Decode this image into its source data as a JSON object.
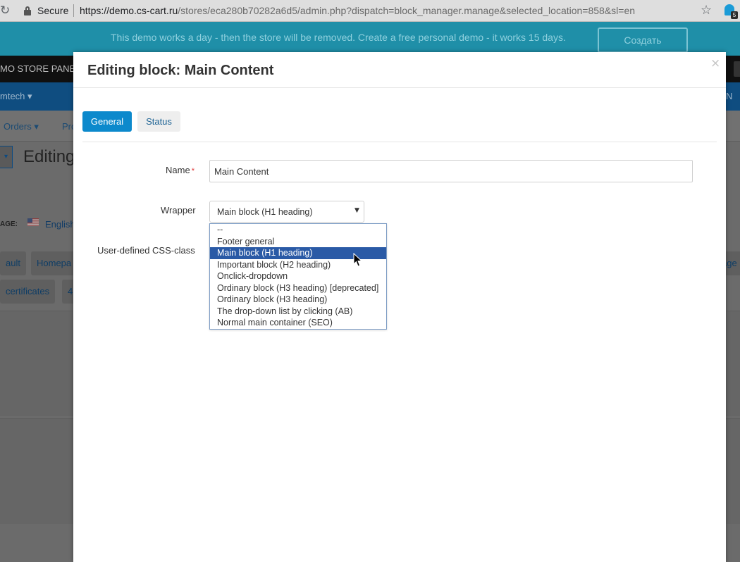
{
  "browser": {
    "secure_label": "Secure",
    "url_host": "https://demo.cs-cart.ru",
    "url_path": "/stores/eca280b70282a6d5/admin.php?dispatch=block_manager.manage&selected_location=858&sl=en",
    "extension_badge": "5"
  },
  "background": {
    "demo_notice": "This demo works a day - then the store will be removed. Create a free personal demo - it works 15 days.",
    "create_button": "Создать",
    "store_panel": "MO STORE PANE",
    "vendor": "mtech",
    "menu_orders": "Orders",
    "menu_products": "Pro",
    "page_title": "Editing",
    "language_label": "AGE:",
    "language_value": "English",
    "layout_default": "ault",
    "layout_homepage": "Homepa",
    "layout_page": "age",
    "layout_certificates": "certificates",
    "layout_extra": "4",
    "lang_right": "N"
  },
  "modal": {
    "title": "Editing block: Main Content",
    "close_label": "×",
    "tabs": [
      {
        "label": "General"
      },
      {
        "label": "Status"
      }
    ],
    "fields": {
      "name_label": "Name",
      "name_required": "*",
      "name_value": "Main Content",
      "wrapper_label": "Wrapper",
      "wrapper_value": "Main block (H1 heading)",
      "css_label": "User-defined CSS-class"
    },
    "wrapper_options": [
      "--",
      "Footer general",
      "Main block (H1 heading)",
      "Important block (H2 heading)",
      "Onclick-dropdown",
      "Ordinary block (H3 heading) [deprecated]",
      "Ordinary block (H3 heading)",
      "The drop-down list by clicking (AB)",
      "Normal main container (SEO)"
    ],
    "selected_option": "Main block (H1 heading)"
  }
}
